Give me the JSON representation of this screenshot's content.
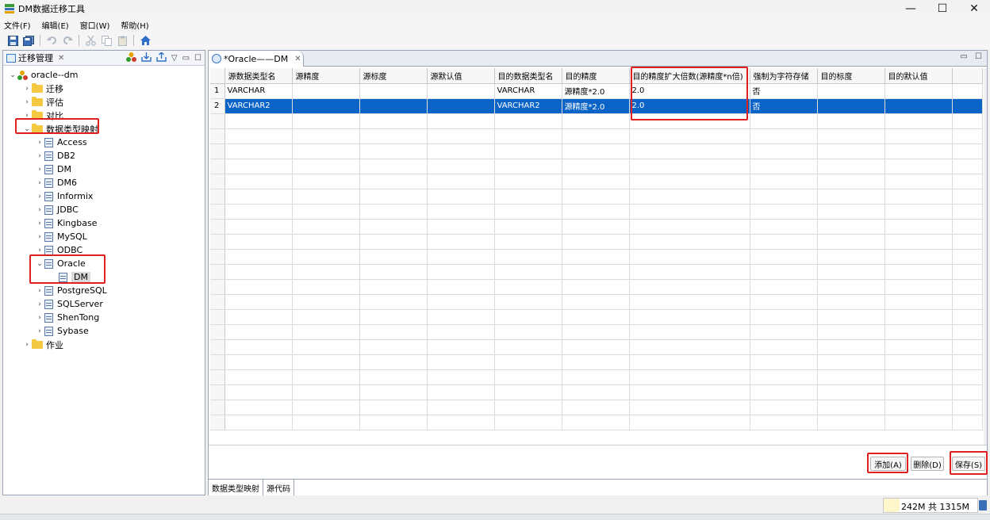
{
  "window": {
    "title": "DM数据迁移工具",
    "minimize": "—",
    "maximize": "☐",
    "close": "✕"
  },
  "menu": [
    "文件(F)",
    "编辑(E)",
    "窗口(W)",
    "帮助(H)"
  ],
  "left_view": {
    "title": "迁移管理",
    "close": "✕",
    "tree": {
      "root": "oracle--dm",
      "migrate": "迁移",
      "evaluate": "评估",
      "compare": "对比",
      "type_mapping": "数据类型映射",
      "sources": [
        "Access",
        "DB2",
        "DM",
        "DM6",
        "Informix",
        "JDBC",
        "Kingbase",
        "MySQL",
        "ODBC"
      ],
      "oracle": "Oracle",
      "oracle_child": "DM",
      "sources_after": [
        "PostgreSQL",
        "SQLServer",
        "ShenTong",
        "Sybase"
      ],
      "jobs": "作业"
    }
  },
  "editor": {
    "tab_title": "*Oracle——DM",
    "close": "✕",
    "columns": [
      "源数据类型名",
      "源精度",
      "源标度",
      "源默认值",
      "目的数据类型名",
      "目的精度",
      "目的精度扩大倍数(源精度*n倍)",
      "强制为字符存储",
      "目的标度",
      "目的默认值"
    ],
    "rows": [
      [
        "1",
        "VARCHAR",
        "",
        "",
        "",
        "VARCHAR",
        "源精度*2.0",
        "2.0",
        "否",
        "",
        ""
      ],
      [
        "2",
        "VARCHAR2",
        "",
        "",
        "",
        "VARCHAR2",
        "源精度*2.0",
        "2.0",
        "否",
        "",
        ""
      ]
    ],
    "buttons": {
      "add": "添加(A)",
      "delete": "删除(D)",
      "save": "保存(S)"
    },
    "bottom_tabs": [
      "数据类型映射",
      "源代码"
    ]
  },
  "status": {
    "memory": "242M 共 1315M"
  }
}
